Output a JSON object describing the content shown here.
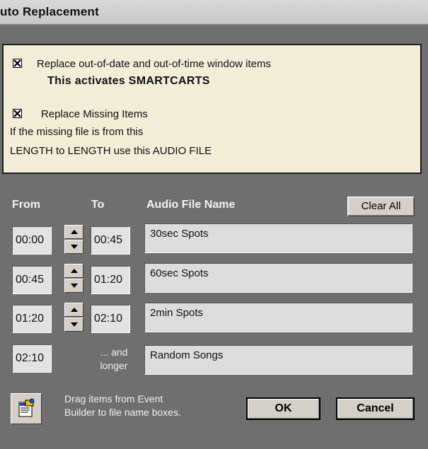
{
  "window": {
    "title": "uto Replacement"
  },
  "options": {
    "replace_out_of_date": {
      "checked": true,
      "label": "Replace out-of-date and out-of-time window items"
    },
    "smartcarts_note": "This activates SMARTCARTS",
    "replace_missing": {
      "checked": true,
      "label": "Replace Missing Items"
    },
    "missing_desc_line1": "If the missing file is from this",
    "missing_desc_line2": "LENGTH to LENGTH use this AUDIO FILE"
  },
  "table": {
    "headers": {
      "from": "From",
      "to": "To",
      "file": "Audio File Name"
    },
    "clear_all_label": "Clear All",
    "rows": [
      {
        "from": "00:00",
        "to": "00:45",
        "file": "30sec Spots"
      },
      {
        "from": "00:45",
        "to": "01:20",
        "file": "60sec Spots"
      },
      {
        "from": "01:20",
        "to": "02:10",
        "file": "2min Spots"
      }
    ],
    "last_row": {
      "from": "02:10",
      "to_text_1": "... and",
      "to_text_2": "longer",
      "file": "Random Songs"
    }
  },
  "footer": {
    "hint_line1": "Drag items from Event",
    "hint_line2": "Builder to file name boxes.",
    "ok_label": "OK",
    "cancel_label": "Cancel",
    "icon": "event-builder-icon"
  }
}
